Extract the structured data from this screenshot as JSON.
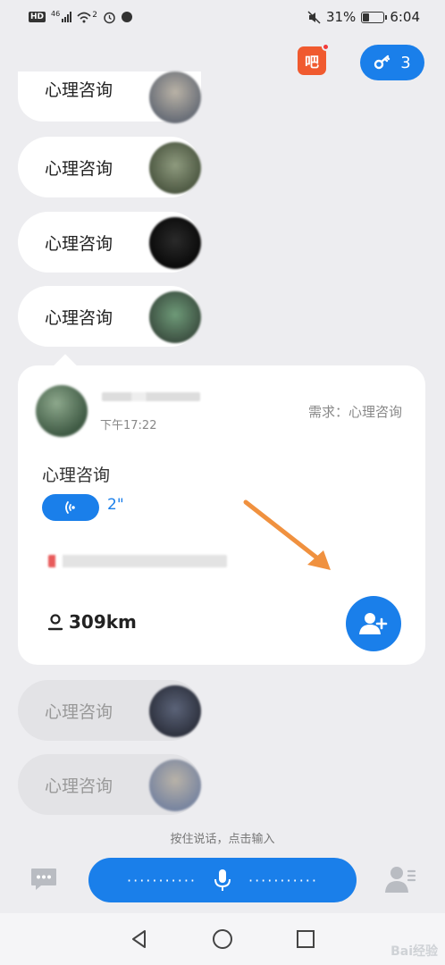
{
  "status_bar": {
    "hd": "HD",
    "network": "46",
    "wifi_sub": "2",
    "battery_pct": "31%",
    "battery_level": 0.31,
    "time": "6:04"
  },
  "top_actions": {
    "bar_app_label": "吧",
    "key_count": "3"
  },
  "requests": [
    {
      "label": "心理咨询"
    },
    {
      "label": "心理咨询"
    },
    {
      "label": "心理咨询"
    },
    {
      "label": "心理咨询"
    }
  ],
  "card": {
    "time": "下午17:22",
    "need": "需求：心理咨询",
    "title": "心理咨询",
    "voice_duration": "2\"",
    "distance": "309km"
  },
  "faded_requests": [
    {
      "label": "心理咨询"
    },
    {
      "label": "心理咨询"
    }
  ],
  "bottom": {
    "hint": "按住说话，点击输入",
    "mic_dots_left": "···········",
    "mic_dots_right": "···········"
  },
  "watermark": "Bai经验",
  "colors": {
    "accent": "#1a7fea",
    "background": "#ededf0",
    "arrow": "#f0913f"
  }
}
